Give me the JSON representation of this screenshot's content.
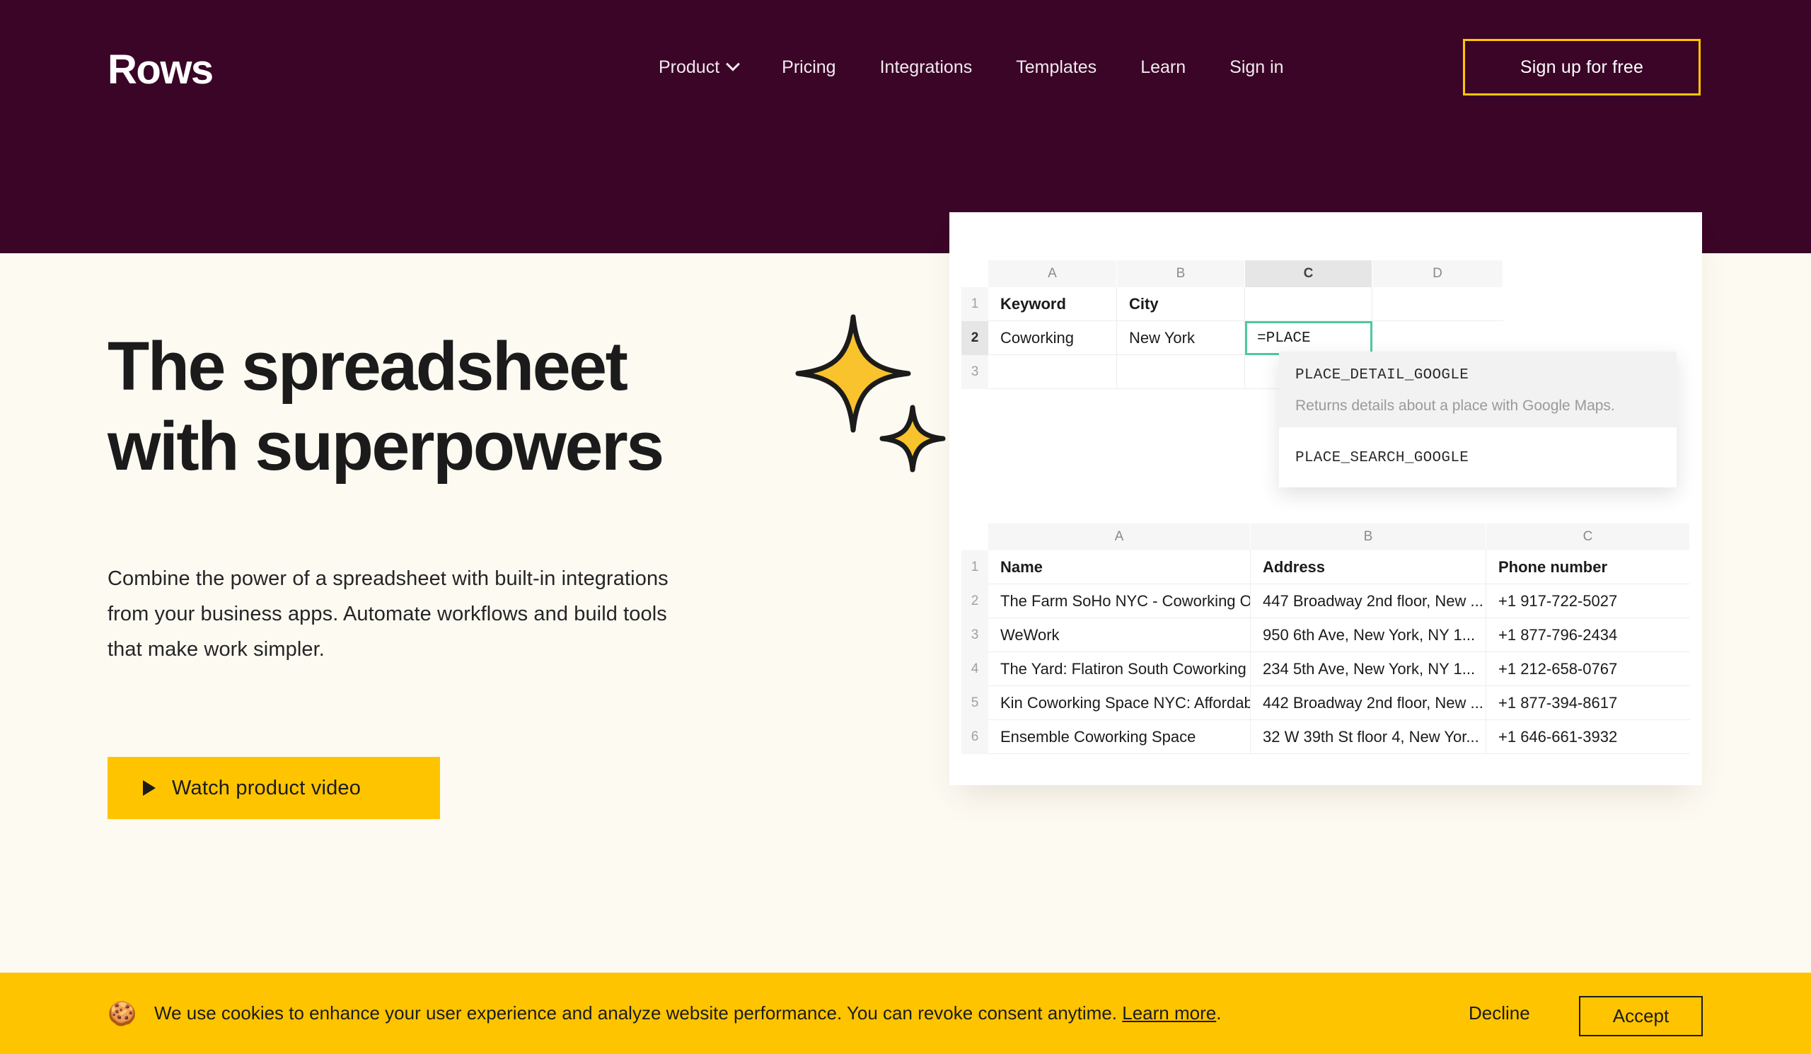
{
  "brand": {
    "logo_text": "Rows",
    "accent_yellow": "#FFC400",
    "header_bg": "#3A0527",
    "page_bg": "#FDFAF2",
    "cell_focus": "#4DC9A0"
  },
  "nav": {
    "items": [
      {
        "label": "Product",
        "has_chevron": true,
        "icon": "chevron-down-icon"
      },
      {
        "label": "Pricing",
        "has_chevron": false
      },
      {
        "label": "Integrations",
        "has_chevron": false
      },
      {
        "label": "Templates",
        "has_chevron": false
      },
      {
        "label": "Learn",
        "has_chevron": false
      },
      {
        "label": "Sign in",
        "has_chevron": false
      }
    ],
    "cta_label": "Sign up for free"
  },
  "hero": {
    "title_line1": "The spreadsheet",
    "title_line2": "with superpowers",
    "paragraph": "Combine the power of a spreadsheet with built-in integrations from your business apps. Automate workflows and build tools that make work simpler.",
    "video_button_label": "Watch product video",
    "play_icon": "play-triangle-icon",
    "sparkle_icon": "sparkle-icon"
  },
  "spreadsheet": {
    "formula_sheet": {
      "column_headers": [
        "A",
        "B",
        "C",
        "D"
      ],
      "active_column": "C",
      "row_labels": [
        "1",
        "2",
        "3"
      ],
      "active_row": "2",
      "rows": [
        {
          "label": "1",
          "cells": [
            "Keyword",
            "City",
            "",
            ""
          ],
          "bold": true
        },
        {
          "label": "2",
          "cells": [
            "Coworking",
            "New York",
            "=PLACE",
            ""
          ],
          "bold": false
        },
        {
          "label": "3",
          "cells": [
            "",
            "",
            "",
            ""
          ],
          "bold": false
        }
      ],
      "editing_cell_value": "=PLACE"
    },
    "autocomplete": {
      "options": [
        {
          "name": "PLACE_DETAIL_GOOGLE",
          "description": "Returns details about a place with Google Maps.",
          "highlighted": true
        },
        {
          "name": "PLACE_SEARCH_GOOGLE",
          "description": "",
          "highlighted": false
        }
      ]
    },
    "results_sheet": {
      "column_headers": [
        "A",
        "B",
        "C"
      ],
      "header_row": {
        "label": "1",
        "cells": [
          "Name",
          "Address",
          "Phone number"
        ]
      },
      "rows": [
        {
          "label": "2",
          "cells": [
            "The Farm SoHo NYC - Coworking Offi...",
            "447 Broadway 2nd floor, New ...",
            "+1 917-722-5027"
          ]
        },
        {
          "label": "3",
          "cells": [
            "WeWork",
            "950 6th Ave, New York, NY 1...",
            "+1 877-796-2434"
          ]
        },
        {
          "label": "4",
          "cells": [
            "The Yard: Flatiron South Coworking ...",
            "234 5th Ave, New York, NY 1...",
            "+1 212-658-0767"
          ]
        },
        {
          "label": "5",
          "cells": [
            "Kin Coworking Space NYC: Affordab...",
            "442 Broadway 2nd floor, New ...",
            "+1 877-394-8617"
          ]
        },
        {
          "label": "6",
          "cells": [
            "Ensemble Coworking Space",
            "32 W 39th St floor 4, New Yor...",
            "+1 646-661-3932"
          ]
        }
      ]
    }
  },
  "cookie_banner": {
    "emoji": "🍪",
    "text_before": "We use cookies to enhance your user experience and analyze website performance. You can revoke consent anytime. ",
    "link_label": "Learn more",
    "text_after": ".",
    "decline_label": "Decline",
    "accept_label": "Accept"
  }
}
